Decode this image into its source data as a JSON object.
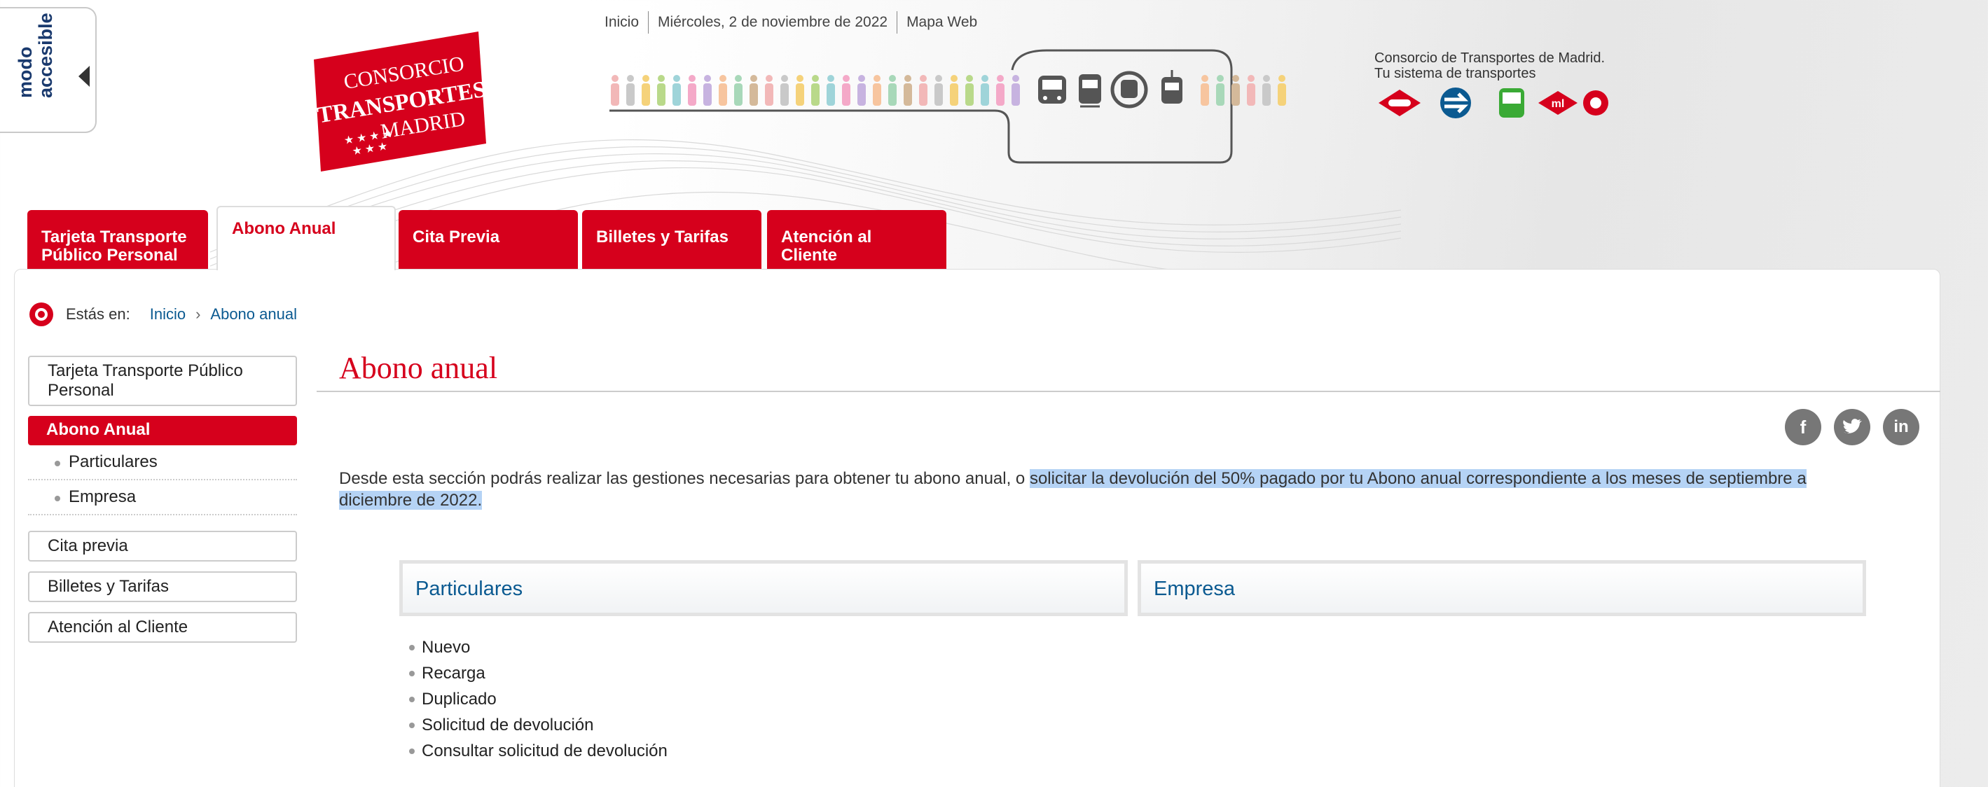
{
  "accessible_mode": {
    "label": "modo accesible"
  },
  "logo": {
    "line1": "CONSORCIO",
    "line2": "TRANSPORTES",
    "line3": "MADRID"
  },
  "top_links": [
    "Inicio",
    "Miércoles, 2 de noviembre de 2022",
    "Mapa Web"
  ],
  "consorcio": {
    "line1": "Consorcio de Transportes de Madrid.",
    "line2": "Tu sistema de transportes"
  },
  "transport_modes": [
    "metro-icon",
    "cercanias-icon",
    "bus-icon",
    "metro-ligero-icon",
    "interurbano-icon"
  ],
  "tabs": [
    {
      "label": "Tarjeta Transporte Público Personal"
    },
    {
      "label": "Abono Anual"
    },
    {
      "label": "Cita Previa"
    },
    {
      "label": "Billetes y Tarifas"
    },
    {
      "label": "Atención al Cliente"
    }
  ],
  "breadcrumb": {
    "label": "Estás en:",
    "items": [
      "Inicio",
      "Abono anual"
    ]
  },
  "sidebar": {
    "items": [
      {
        "label": "Tarjeta Transporte Público Personal"
      },
      {
        "label": "Abono Anual"
      },
      {
        "label": "Particulares"
      },
      {
        "label": "Empresa"
      },
      {
        "label": "Cita previa"
      },
      {
        "label": "Billetes y Tarifas"
      },
      {
        "label": "Atención al Cliente"
      }
    ]
  },
  "main": {
    "title": "Abono anual",
    "social": [
      "f",
      "t",
      "in"
    ],
    "desc_plain": "Desde esta sección podrás realizar las gestiones necesarias para obtener tu abono anual, o ",
    "desc_highlight": "solicitar la devolución del 50% pagado por tu Abono anual correspondiente a los meses de septiembre a diciembre de 2022.",
    "cards": [
      "Particulares",
      "Empresa"
    ],
    "list": [
      "Nuevo",
      "Recarga",
      "Duplicado",
      "Solicitud de devolución",
      "Consultar solicitud de devolución"
    ]
  },
  "colors": {
    "brand_red": "#d6001c",
    "link_blue": "#0b5a91",
    "highlight": "#b5d3f5"
  }
}
